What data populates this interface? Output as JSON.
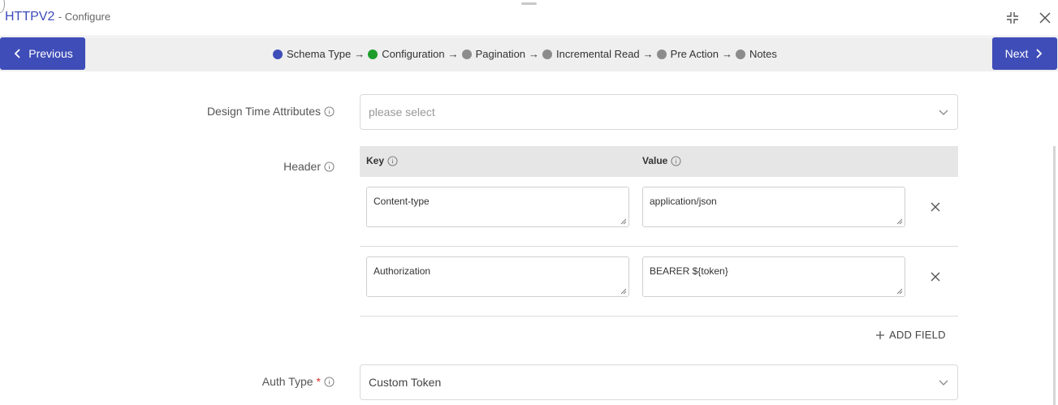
{
  "window": {
    "title": "HTTPV2",
    "subtitle": "- Configure"
  },
  "nav": {
    "previous_label": "Previous",
    "next_label": "Next"
  },
  "steps": [
    {
      "label": "Schema Type",
      "color": "#3f4db8"
    },
    {
      "label": "Configuration",
      "color": "#1f9d2b"
    },
    {
      "label": "Pagination",
      "color": "#8c8c8c"
    },
    {
      "label": "Incremental Read",
      "color": "#8c8c8c"
    },
    {
      "label": "Pre Action",
      "color": "#8c8c8c"
    },
    {
      "label": "Notes",
      "color": "#8c8c8c"
    }
  ],
  "step_separator": "→",
  "form": {
    "design_time": {
      "label": "Design Time Attributes",
      "placeholder": "please select"
    },
    "header": {
      "label": "Header",
      "key_col": "Key",
      "value_col": "Value",
      "rows": [
        {
          "key": "Content-type",
          "value": "application/json"
        },
        {
          "key": "Authorization",
          "value": "BEARER ${token}"
        }
      ],
      "add_label": "ADD FIELD"
    },
    "auth_type": {
      "label": "Auth Type",
      "required_mark": "*",
      "value": "Custom Token"
    }
  },
  "colors": {
    "accent": "#3f4db8",
    "active_step": "#1f9d2b",
    "pending_step": "#8c8c8c"
  }
}
